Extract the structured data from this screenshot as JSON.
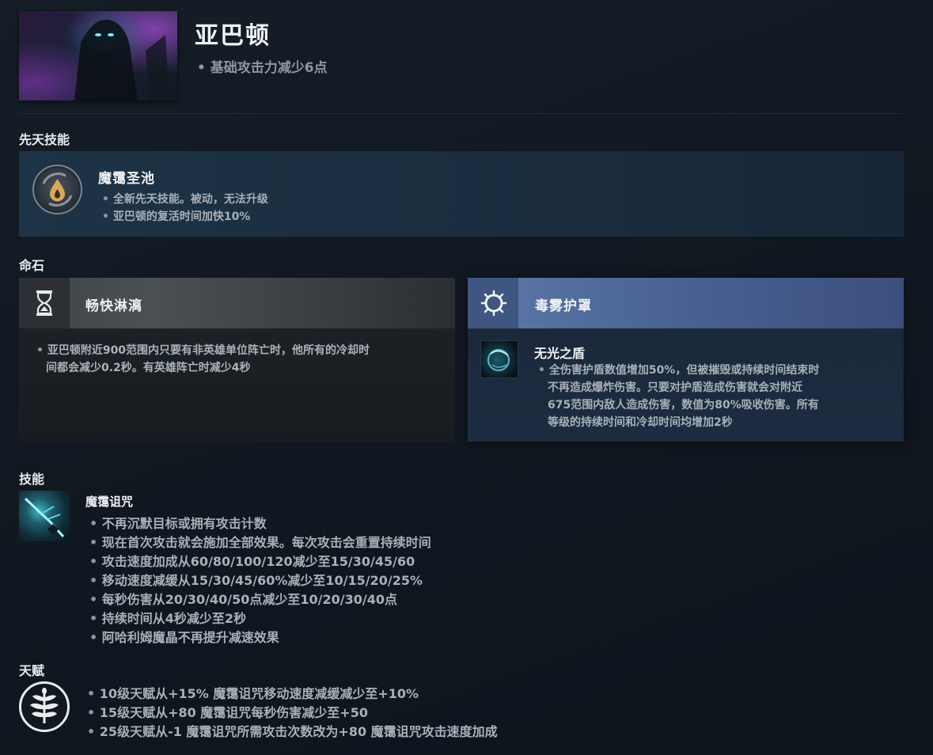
{
  "hero": {
    "name": "亚巴顿",
    "change": "基础攻击力减少6点"
  },
  "sections": {
    "innate": "先天技能",
    "shard": "命石",
    "abilities": "技能",
    "talents": "天赋"
  },
  "innate": {
    "name": "魔霭圣池",
    "lines": [
      "全新先天技能。被动，无法升级",
      "亚巴顿的复活时间加快10%"
    ]
  },
  "shard_card": {
    "title": "畅快淋漓",
    "lines": [
      "亚巴顿附近900范围内只要有非英雄单位阵亡时，他所有的冷却时",
      "间都会减少0.2秒。有英雄阵亡时减少4秒"
    ]
  },
  "scepter_card": {
    "title": "毒雾护罩",
    "ability_name": "无光之盾",
    "lines": [
      "全伤害护盾数值增加50%，但被摧毁或持续时间结束时",
      "不再造成爆炸伤害。只要对护盾造成伤害就会对附近",
      "675范围内敌人造成伤害，数值为80%吸收伤害。所有",
      "等级的持续时间和冷却时间均增加2秒"
    ]
  },
  "ability": {
    "name": "魔霭诅咒",
    "lines": [
      "不再沉默目标或拥有攻击计数",
      "现在首次攻击就会施加全部效果。每次攻击会重置持续时间",
      "攻击速度加成从60/80/100/120减少至15/30/45/60",
      "移动速度减缓从15/30/45/60%减少至10/15/20/25%",
      "每秒伤害从20/30/40/50点减少至10/20/30/40点",
      "持续时间从4秒减少至2秒",
      "阿哈利姆魔晶不再提升减速效果"
    ]
  },
  "talents": {
    "lines": [
      "10级天赋从+15% 魔霭诅咒移动速度减缓减少至+10%",
      "15级天赋从+80 魔霭诅咒每秒伤害减少至+50",
      "25级天赋从-1 魔霭诅咒所需攻击次数改为+80 魔霭诅咒攻击速度加成"
    ]
  },
  "icons": {
    "innate": "droplet-icon",
    "shard": "hourglass-icon",
    "scepter": "spiked-ring-icon",
    "talent": "talent-tree-icon"
  }
}
